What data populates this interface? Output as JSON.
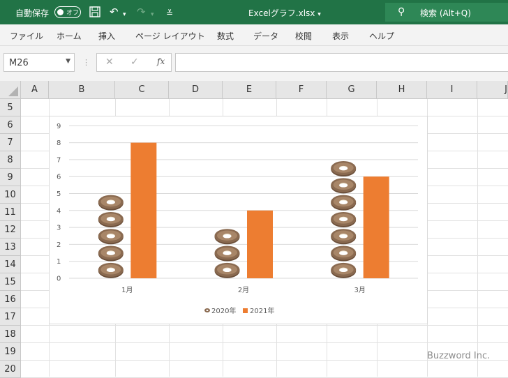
{
  "titlebar": {
    "autosave_label": "自動保存",
    "autosave_state": "オフ",
    "doc_title": "Excelグラフ.xlsx",
    "doc_title_chevron": "▾",
    "search_label": "検索 (Alt+Q)"
  },
  "menu": [
    "ファイル",
    "ホーム",
    "挿入",
    "ページ レイアウト",
    "数式",
    "データ",
    "校閲",
    "表示",
    "ヘルプ"
  ],
  "formula_bar": {
    "namebox_value": "M26",
    "fx_label": "fx",
    "formula": ""
  },
  "sheet": {
    "columns": [
      "A",
      "B",
      "C",
      "D",
      "E",
      "F",
      "G",
      "H",
      "I",
      "J"
    ],
    "rows": [
      "5",
      "6",
      "7",
      "8",
      "9",
      "10",
      "11",
      "12",
      "13",
      "14",
      "15",
      "16",
      "17",
      "18",
      "19",
      "20"
    ]
  },
  "chart_data": {
    "type": "bar",
    "categories": [
      "1月",
      "2月",
      "3月"
    ],
    "series": [
      {
        "name": "2020年",
        "values": [
          5,
          3,
          7
        ],
        "color": "#8a6a50",
        "marker": "donut-icon"
      },
      {
        "name": "2021年",
        "values": [
          8,
          4,
          6
        ],
        "color": "#ed7d31"
      }
    ],
    "ylim": [
      0,
      9
    ],
    "yticks": [
      "0",
      "1",
      "2",
      "3",
      "4",
      "5",
      "6",
      "7",
      "8",
      "9"
    ],
    "title": "",
    "xlabel": "",
    "ylabel": "",
    "grid": true,
    "legend": "bottom"
  },
  "watermark": "Buzzword Inc.",
  "colors": {
    "accent": "#217346",
    "bar_2021": "#ed7d31",
    "donut": "#8a6a50"
  }
}
